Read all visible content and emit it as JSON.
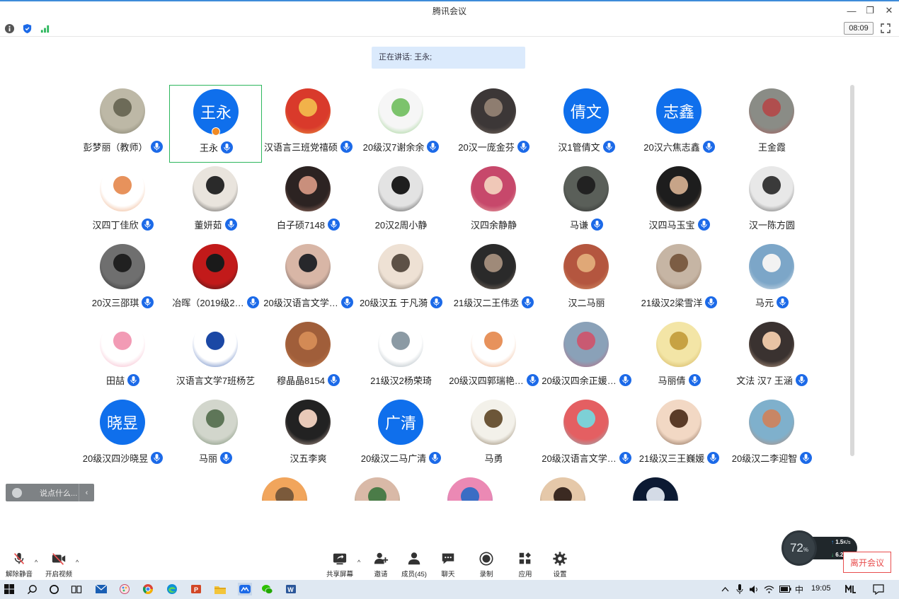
{
  "window": {
    "title": "腾讯会议",
    "minimize_glyph": "—",
    "restore_glyph": "❐",
    "close_glyph": "✕"
  },
  "status": {
    "timer": "08:09",
    "icons": [
      "info-icon",
      "security-shield-icon",
      "signal-strength-icon"
    ]
  },
  "speaking": {
    "text": "正在讲话: 王永;"
  },
  "participants": [
    {
      "name": "彭梦丽（教师）",
      "avatar": "photo",
      "colors": [
        "#bdb8a6",
        "#6d6b58"
      ],
      "mic": true
    },
    {
      "name": "王永",
      "avatar": "text",
      "avatar_text": "王永",
      "mic": true,
      "active": true,
      "host": true
    },
    {
      "name": "汉语言三班党禧硕",
      "avatar": "photo",
      "colors": [
        "#d93a2b",
        "#f1b24a"
      ],
      "mic": true
    },
    {
      "name": "20级汉7谢余余",
      "avatar": "photo",
      "colors": [
        "#f6f6f6",
        "#7cc36c"
      ],
      "mic": true
    },
    {
      "name": "20汉一庞金芬",
      "avatar": "photo",
      "colors": [
        "#3c3737",
        "#8e7d70"
      ],
      "mic": true
    },
    {
      "name": "汉1管倩文",
      "avatar": "text",
      "avatar_text": "倩文",
      "mic": true
    },
    {
      "name": "20汉六焦志鑫",
      "avatar": "text",
      "avatar_text": "志鑫",
      "mic": true
    },
    {
      "name": "王金霞",
      "avatar": "photo",
      "colors": [
        "#8a8c86",
        "#b04e4e"
      ],
      "mic": false
    },
    {
      "name": "汉四丁佳欣",
      "avatar": "photo",
      "colors": [
        "#ffffff",
        "#e7925c"
      ],
      "mic": true
    },
    {
      "name": "董妍茹",
      "avatar": "photo",
      "colors": [
        "#e9e4dd",
        "#2a2a2a"
      ],
      "mic": true
    },
    {
      "name": "白子硕7148",
      "avatar": "photo",
      "colors": [
        "#2c2322",
        "#c98f7c"
      ],
      "mic": true
    },
    {
      "name": "20汉2周小静",
      "avatar": "photo",
      "colors": [
        "#e3e3e3",
        "#1e1e1e"
      ],
      "mic": false
    },
    {
      "name": "汉四余静静",
      "avatar": "photo",
      "colors": [
        "#c7486b",
        "#f0c8b8"
      ],
      "mic": false
    },
    {
      "name": "马谦",
      "avatar": "photo",
      "colors": [
        "#5a5f59",
        "#222"
      ],
      "mic": true
    },
    {
      "name": "汉四马玉宝",
      "avatar": "photo",
      "colors": [
        "#1d1d1d",
        "#c7a488"
      ],
      "mic": true
    },
    {
      "name": "汉一陈方圆",
      "avatar": "photo",
      "colors": [
        "#e8e8e8",
        "#3a3a3a"
      ],
      "mic": false
    },
    {
      "name": "20汉三邵琪",
      "avatar": "photo",
      "colors": [
        "#6f6f6f",
        "#202020"
      ],
      "mic": true
    },
    {
      "name": "冶晖（2019级2…",
      "avatar": "photo",
      "colors": [
        "#c21a1a",
        "#1a1a1a"
      ],
      "mic": true
    },
    {
      "name": "20级汉语言文学…",
      "avatar": "photo",
      "colors": [
        "#d8b6a6",
        "#27272b"
      ],
      "mic": true
    },
    {
      "name": "20级汉五 于凡漪",
      "avatar": "photo",
      "colors": [
        "#eee1d4",
        "#5d5146"
      ],
      "mic": true
    },
    {
      "name": "21级汉二王伟丞",
      "avatar": "photo",
      "colors": [
        "#2a2a2a",
        "#9f8a79"
      ],
      "mic": true
    },
    {
      "name": "汉二马丽",
      "avatar": "photo",
      "colors": [
        "#b4563f",
        "#e0a877"
      ],
      "mic": false
    },
    {
      "name": "21级汉2梁雪洋",
      "avatar": "photo",
      "colors": [
        "#c6b5a4",
        "#7c5d44"
      ],
      "mic": true
    },
    {
      "name": "马元",
      "avatar": "photo",
      "colors": [
        "#7ca6c8",
        "#f2f2f2"
      ],
      "mic": true
    },
    {
      "name": "田喆",
      "avatar": "photo",
      "colors": [
        "#ffffff",
        "#f29bb5"
      ],
      "mic": true
    },
    {
      "name": "汉语言文学7班杨艺",
      "avatar": "photo",
      "colors": [
        "#ffffff",
        "#1b48a5"
      ],
      "mic": false
    },
    {
      "name": "穆晶晶8154",
      "avatar": "photo",
      "colors": [
        "#a05e3a",
        "#d38a55"
      ],
      "mic": true
    },
    {
      "name": "21级汉2杨荣琦",
      "avatar": "photo",
      "colors": [
        "#ffffff",
        "#8b9aa4"
      ],
      "mic": false
    },
    {
      "name": "20级汉四郭瑞艳…",
      "avatar": "photo",
      "colors": [
        "#ffffff",
        "#e7925c"
      ],
      "mic": true
    },
    {
      "name": "20级汉四余正媛…",
      "avatar": "photo",
      "colors": [
        "#8aa1b8",
        "#c95a72"
      ],
      "mic": true
    },
    {
      "name": "马丽倩",
      "avatar": "photo",
      "colors": [
        "#f3e5a6",
        "#c7a243"
      ],
      "mic": true
    },
    {
      "name": "文法 汉7 王涵",
      "avatar": "photo",
      "colors": [
        "#3a3230",
        "#e8c3a4"
      ],
      "mic": true
    },
    {
      "name": "20级汉四沙晓昱",
      "avatar": "text",
      "avatar_text": "晓昱",
      "mic": true
    },
    {
      "name": "马丽",
      "avatar": "photo",
      "colors": [
        "#d2d6cc",
        "#5e7658"
      ],
      "mic": true
    },
    {
      "name": "汉五李爽",
      "avatar": "photo",
      "colors": [
        "#222",
        "#e8c9b8"
      ],
      "mic": false
    },
    {
      "name": "20级汉二马广清",
      "avatar": "text",
      "avatar_text": "广清",
      "mic": true
    },
    {
      "name": "马勇",
      "avatar": "photo",
      "colors": [
        "#f3f1ea",
        "#6c5638"
      ],
      "mic": false
    },
    {
      "name": "20级汉语言文学…",
      "avatar": "photo",
      "colors": [
        "#e45f62",
        "#7dd0d6"
      ],
      "mic": true
    },
    {
      "name": "21级汉三王巍媛",
      "avatar": "photo",
      "colors": [
        "#f2d8c4",
        "#5a3b27"
      ],
      "mic": true
    },
    {
      "name": "20级汉二李迎智",
      "avatar": "photo",
      "colors": [
        "#7fb0cc",
        "#c88665"
      ],
      "mic": true
    },
    {
      "name": "",
      "avatar": "photo",
      "colors": [
        "#f1a55c",
        "#7b5a3b"
      ],
      "mic": false
    },
    {
      "name": "",
      "avatar": "photo",
      "colors": [
        "#d9b9a7",
        "#4b7c48"
      ],
      "mic": false
    },
    {
      "name": "",
      "avatar": "photo",
      "colors": [
        "#eb89b4",
        "#3a6dc4"
      ],
      "mic": false
    },
    {
      "name": "",
      "avatar": "photo",
      "colors": [
        "#e5c8a9",
        "#3b2a22"
      ],
      "mic": false
    },
    {
      "name": "",
      "avatar": "photo",
      "colors": [
        "#0c1a33",
        "#d4dbe6"
      ],
      "mic": false
    }
  ],
  "chat": {
    "placeholder": "说点什么...",
    "collapse_glyph": "‹"
  },
  "toolbar": {
    "unmute": "解除静音",
    "start_video": "开启视频",
    "share_screen": "共享屏幕",
    "invite": "邀请",
    "members": "成员(45)",
    "chat": "聊天",
    "record": "录制",
    "apps": "应用",
    "settings": "设置",
    "leave": "离开会议",
    "caret": "^"
  },
  "perf": {
    "cpu": "72",
    "cpu_unit": "%",
    "up": "1.5",
    "down": "6.2",
    "unit": "K/s"
  },
  "taskbar": {
    "ime": "中",
    "time": "19:05"
  },
  "colors": {
    "accent": "#0f6fec",
    "active_border": "#2db75d",
    "leave": "#e84d4d",
    "banner": "#dbeafc"
  }
}
